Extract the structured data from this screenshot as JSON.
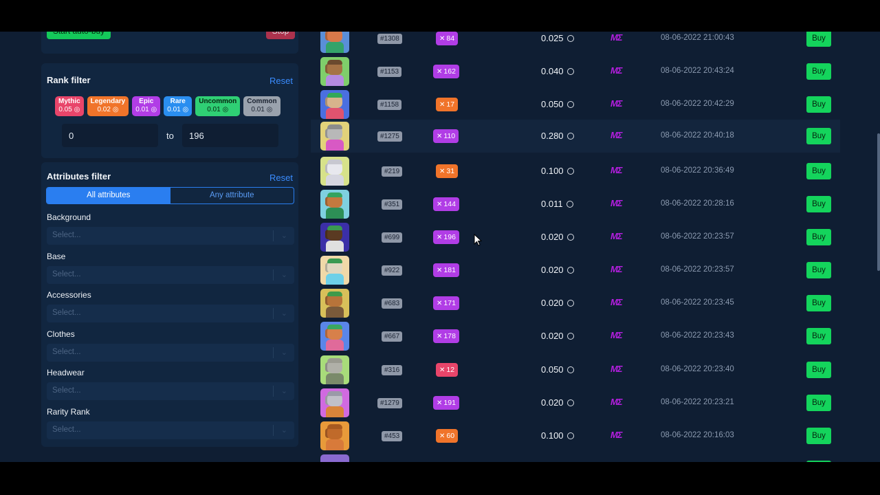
{
  "controls": {
    "start_label": "Start auto-buy",
    "stop_label": "Stop"
  },
  "rank_filter": {
    "title": "Rank filter",
    "reset": "Reset",
    "chips": [
      {
        "name": "Mythic",
        "price": "0.05",
        "color": "#e8456a",
        "text": "#ffffff"
      },
      {
        "name": "Legendary",
        "price": "0.02",
        "color": "#f0742a",
        "text": "#ffffff"
      },
      {
        "name": "Epic",
        "price": "0.01",
        "color": "#b13de6",
        "text": "#ffffff"
      },
      {
        "name": "Rare",
        "price": "0.01",
        "color": "#2a8ef0",
        "text": "#ffffff"
      },
      {
        "name": "Uncommon",
        "price": "0.01",
        "color": "#2fcf74",
        "text": "#06240f"
      },
      {
        "name": "Common",
        "price": "0.01",
        "color": "#9aa2ad",
        "text": "#1a2230"
      }
    ],
    "from": "0",
    "to_label": "to",
    "to": "196"
  },
  "attributes_filter": {
    "title": "Attributes filter",
    "reset": "Reset",
    "mode_all": "All attributes",
    "mode_any": "Any attribute",
    "fields": [
      {
        "label": "Background",
        "placeholder": "Select..."
      },
      {
        "label": "Base",
        "placeholder": "Select..."
      },
      {
        "label": "Accessories",
        "placeholder": "Select..."
      },
      {
        "label": "Clothes",
        "placeholder": "Select..."
      },
      {
        "label": "Headwear",
        "placeholder": "Select..."
      },
      {
        "label": "Rarity Rank",
        "placeholder": "Select..."
      }
    ]
  },
  "listings": [
    {
      "id": "#1308",
      "rank": "84",
      "tier": "epic",
      "price": "0.025",
      "market": "ME",
      "date": "08-06-2022 21:00:43",
      "buy": "Buy",
      "bg": "#5a8fd8",
      "fur": "#d9794a",
      "hat": "#e9547a",
      "shirt": "#34a36a"
    },
    {
      "id": "#1153",
      "rank": "162",
      "tier": "epic",
      "price": "0.040",
      "market": "ME",
      "date": "08-06-2022 20:43:24",
      "buy": "Buy",
      "bg": "#7fce6b",
      "fur": "#a57345",
      "hat": "#6b4a2e",
      "shirt": "#b58be0"
    },
    {
      "id": "#1158",
      "rank": "17",
      "tier": "legendary",
      "price": "0.050",
      "market": "ME",
      "date": "08-06-2022 20:42:29",
      "buy": "Buy",
      "bg": "#4a6fe0",
      "fur": "#d7b48c",
      "hat": "#32a858",
      "shirt": "#e0536f"
    },
    {
      "id": "#1275",
      "rank": "110",
      "tier": "epic",
      "price": "0.280",
      "market": "ME",
      "date": "08-06-2022 20:40:18",
      "buy": "Buy",
      "bg": "#e2d27a",
      "fur": "#b8b8b8",
      "hat": "#8c8c8c",
      "shirt": "#d859c4"
    },
    {
      "id": "#219",
      "rank": "31",
      "tier": "legendary",
      "price": "0.100",
      "market": "ME",
      "date": "08-06-2022 20:36:49",
      "buy": "Buy",
      "bg": "#d7e28a",
      "fur": "#e8e8ee",
      "hat": "#c8c8d0",
      "shirt": "#d6d6e0"
    },
    {
      "id": "#351",
      "rank": "144",
      "tier": "epic",
      "price": "0.011",
      "market": "ME",
      "date": "08-06-2022 20:28:16",
      "buy": "Buy",
      "bg": "#7fd0e0",
      "fur": "#c4793f",
      "hat": "#34a35f",
      "shirt": "#2d8f56"
    },
    {
      "id": "#699",
      "rank": "196",
      "tier": "epic",
      "price": "0.020",
      "market": "ME",
      "date": "08-06-2022 20:23:57",
      "buy": "Buy",
      "bg": "#3b2fa8",
      "fur": "#5a3a22",
      "hat": "#3a9a50",
      "shirt": "#e0e0e0"
    },
    {
      "id": "#922",
      "rank": "181",
      "tier": "epic",
      "price": "0.020",
      "market": "ME",
      "date": "08-06-2022 20:23:57",
      "buy": "Buy",
      "bg": "#f0d9a8",
      "fur": "#e0d8c0",
      "hat": "#3a9a50",
      "shirt": "#6ed0e8"
    },
    {
      "id": "#683",
      "rank": "171",
      "tier": "epic",
      "price": "0.020",
      "market": "ME",
      "date": "08-06-2022 20:23:45",
      "buy": "Buy",
      "bg": "#d8c05a",
      "fur": "#b8743a",
      "hat": "#3f9a4a",
      "shirt": "#7a5a3a"
    },
    {
      "id": "#667",
      "rank": "178",
      "tier": "epic",
      "price": "0.020",
      "market": "ME",
      "date": "08-06-2022 20:23:43",
      "buy": "Buy",
      "bg": "#5a86e8",
      "fur": "#d7804a",
      "hat": "#3aa860",
      "shirt": "#e06a9a"
    },
    {
      "id": "#316",
      "rank": "12",
      "tier": "mythic",
      "price": "0.050",
      "market": "ME",
      "date": "08-06-2022 20:23:40",
      "buy": "Buy",
      "bg": "#a8dc7a",
      "fur": "#b0b0a8",
      "hat": "#9a9a90",
      "shirt": "#7a8a6a"
    },
    {
      "id": "#1279",
      "rank": "191",
      "tier": "epic",
      "price": "0.020",
      "market": "ME",
      "date": "08-06-2022 20:23:21",
      "buy": "Buy",
      "bg": "#d06ae0",
      "fur": "#c0c0c8",
      "hat": "#9a9aa8",
      "shirt": "#d8843a"
    },
    {
      "id": "#453",
      "rank": "60",
      "tier": "legendary",
      "price": "0.100",
      "market": "ME",
      "date": "08-06-2022 20:16:03",
      "buy": "Buy",
      "bg": "#e89a3a",
      "fur": "#c06a2a",
      "hat": "#a85a20",
      "shirt": "#d87a3a"
    }
  ],
  "tier_colors": {
    "mythic": "#e8456a",
    "legendary": "#f0742a",
    "epic": "#b13de6"
  }
}
